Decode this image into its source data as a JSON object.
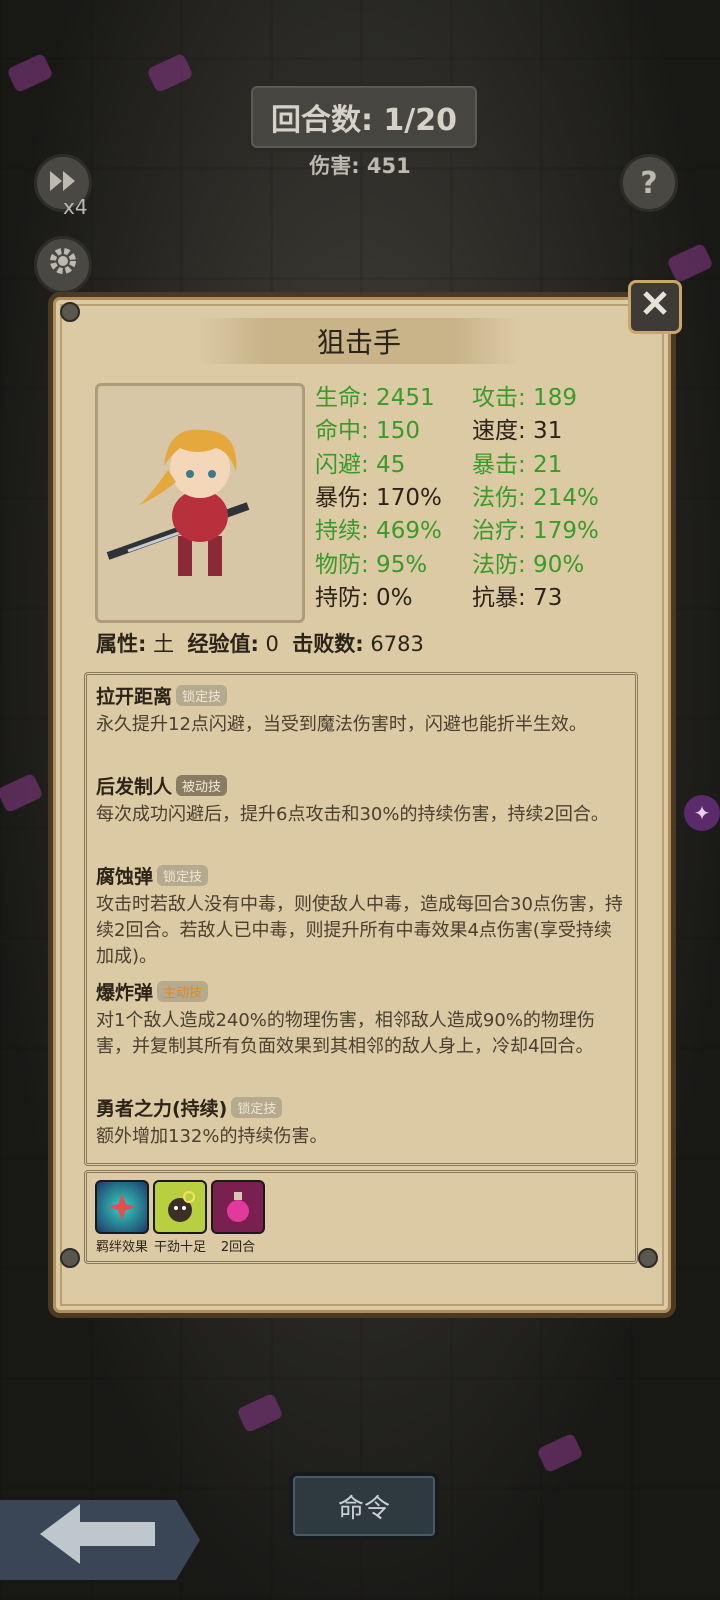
{
  "hud": {
    "round_label": "回合数: 1/20",
    "damage_label": "伤害: 451",
    "speed_multiplier": "x4",
    "fast_forward_icon": "fast-forward-icon",
    "settings_icon": "gear-icon",
    "help_icon": "help-icon",
    "help_glyph": "?"
  },
  "panel": {
    "title": "狙击手",
    "close_icon": "close-icon",
    "stats": {
      "hp": "生命: 2451",
      "atk": "攻击: 189",
      "hit": "命中: 150",
      "spd": "速度: 31",
      "dodge": "闪避: 45",
      "crit": "暴击: 21",
      "crit_dmg": "暴伤: 170%",
      "mag_dmg": "法伤: 214%",
      "dot": "持续: 469%",
      "heal": "治疗: 179%",
      "phys_def": "物防: 95%",
      "mag_def": "法防: 90%",
      "dot_def": "持防: 0%",
      "anti_crit": "抗暴: 73"
    },
    "meta": {
      "attr_label": "属性:",
      "attr_value": "土",
      "exp_label": "经验值:",
      "exp_value": "0",
      "kills_label": "击败数:",
      "kills_value": "6783"
    },
    "skills": [
      {
        "name": "拉开距离",
        "tag": "锁定技",
        "desc": "永久提升12点闪避，当受到魔法伤害时，闪避也能折半生效。"
      },
      {
        "name": "后发制人",
        "tag": "被动技",
        "desc": "每次成功闪避后，提升6点攻击和30%的持续伤害，持续2回合。"
      },
      {
        "name": "腐蚀弹",
        "tag": "锁定技",
        "desc": "攻击时若敌人没有中毒，则使敌人中毒，造成每回合30点伤害，持续2回合。若敌人已中毒，则提升所有中毒效果4点伤害(享受持续加成)。"
      },
      {
        "name": "爆炸弹",
        "tag": "主动技",
        "desc": "对1个敌人造成240%的物理伤害，相邻敌人造成90%的物理伤害，并复制其所有负面效果到其相邻的敌人身上，冷却4回合。"
      },
      {
        "name": "勇者之力(持续)",
        "tag": "锁定技",
        "desc": "额外增加132%的持续伤害。"
      }
    ],
    "effects": [
      {
        "label": "羁绊效果",
        "icon": "bond-icon"
      },
      {
        "label": "干劲十足",
        "icon": "motivated-icon"
      },
      {
        "label": "2回合",
        "icon": "potion-icon"
      }
    ]
  },
  "footer": {
    "command_label": "命令",
    "back_icon": "back-arrow-icon"
  },
  "colors": {
    "green_stat": "#3a9a2a",
    "panel_bg": "#dccaa5",
    "active_tag": "#e58a1c"
  }
}
